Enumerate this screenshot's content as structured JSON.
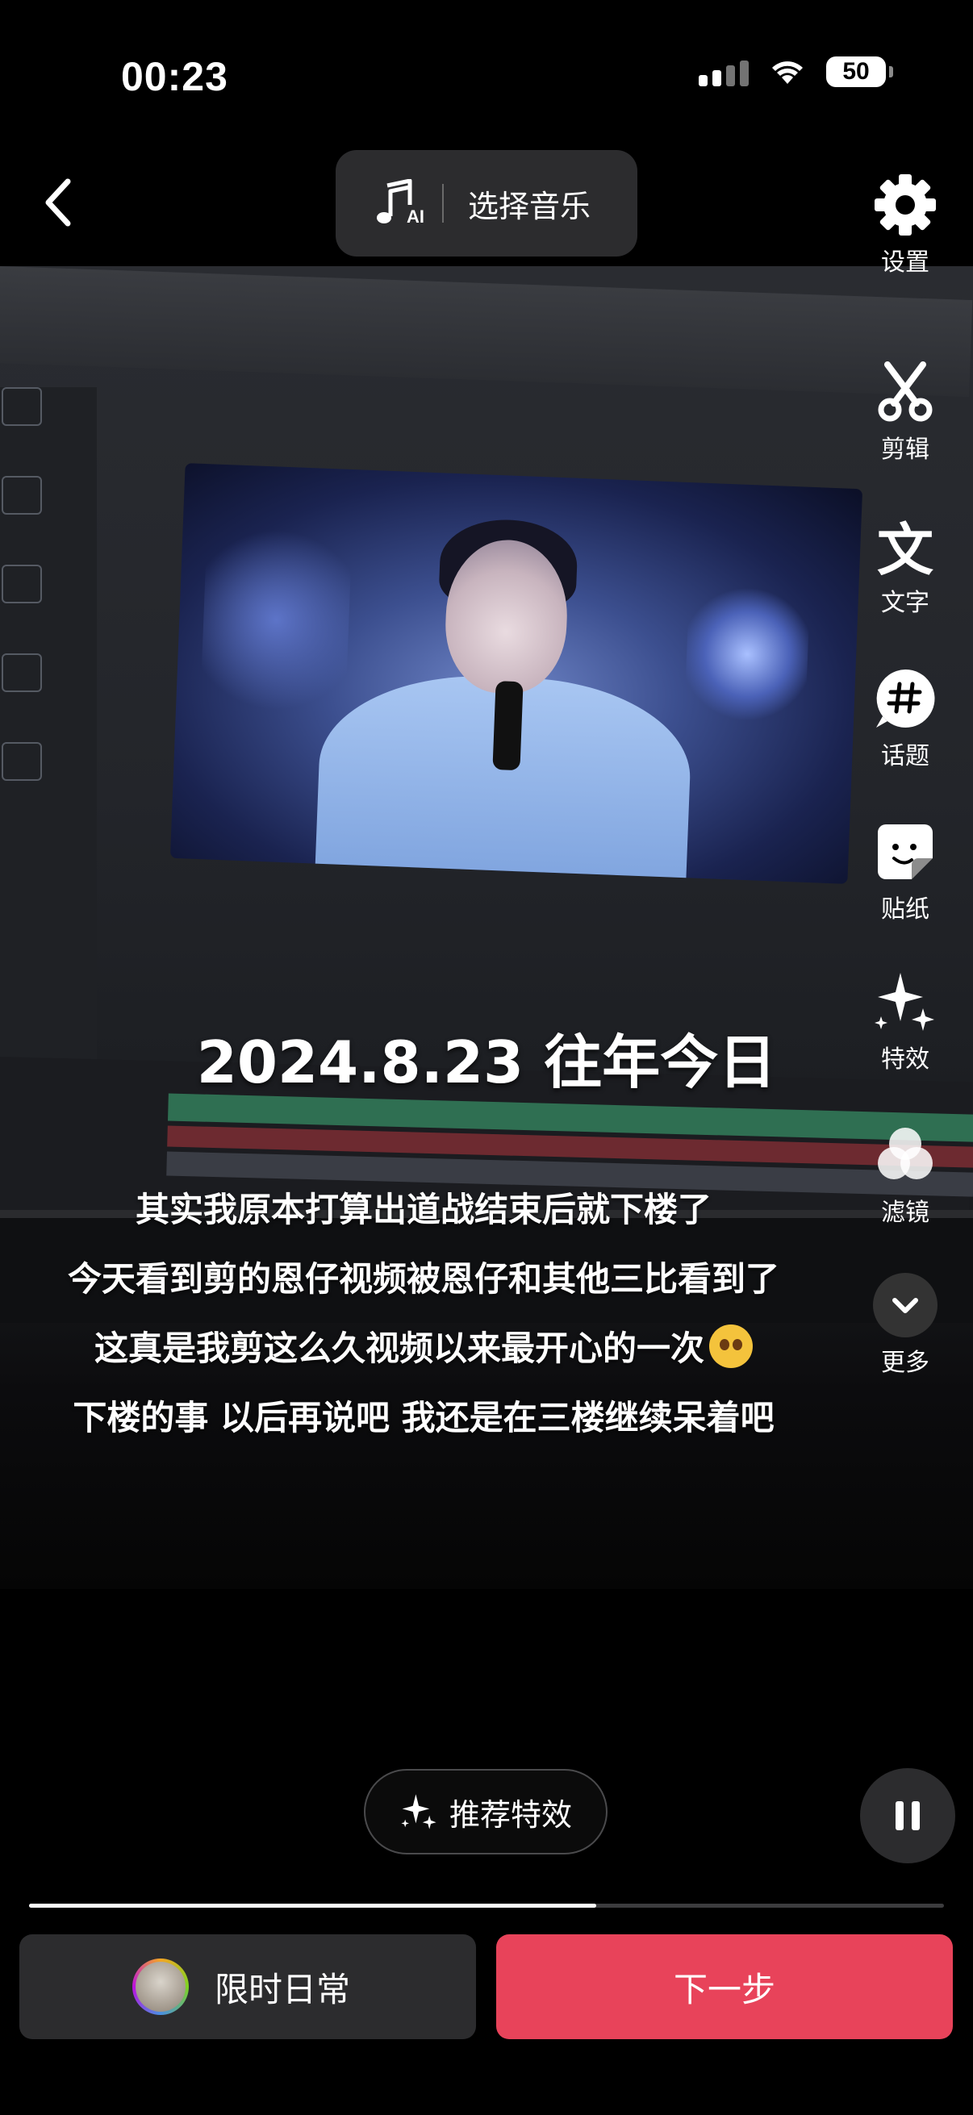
{
  "status_bar": {
    "time": "00:23",
    "battery": "50"
  },
  "top_bar": {
    "music_label": "选择音乐",
    "music_badge": "AI"
  },
  "overlay": {
    "title": "2024.8.23 往年今日",
    "captions": [
      "其实我原本打算出道战结束后就下楼了",
      "今天看到剪的恩仔视频被恩仔和其他三比看到了",
      "这真是我剪这么久视频以来最开心的一次",
      "下楼的事 以后再说吧 我还是在三楼继续呆着吧"
    ]
  },
  "toolbar": [
    {
      "label": "设置",
      "icon": "gear-icon"
    },
    {
      "label": "剪辑",
      "icon": "scissors-icon"
    },
    {
      "label": "文字",
      "icon": "text-icon"
    },
    {
      "label": "话题",
      "icon": "hashtag-icon"
    },
    {
      "label": "贴纸",
      "icon": "sticker-icon"
    },
    {
      "label": "特效",
      "icon": "sparkles-icon"
    },
    {
      "label": "滤镜",
      "icon": "filter-icon"
    },
    {
      "label": "更多",
      "icon": "chevron-down-icon"
    }
  ],
  "bottom": {
    "effects_label": "推荐特效",
    "playback_progress": 0.62,
    "daily_label": "限时日常",
    "next_label": "下一步",
    "accent_color": "#e8435a"
  }
}
